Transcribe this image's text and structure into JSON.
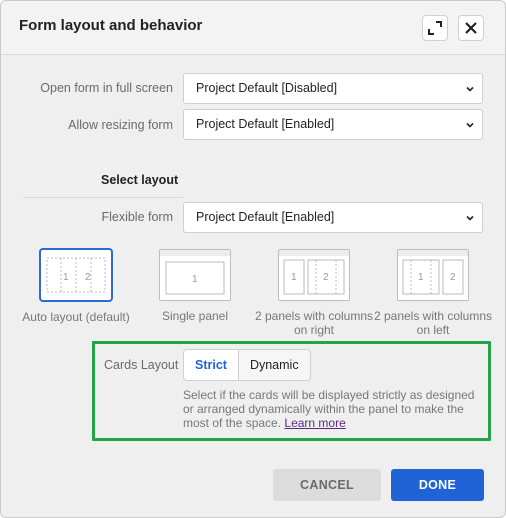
{
  "dialog": {
    "title": "Form layout and behavior"
  },
  "fields": {
    "full_screen": {
      "label": "Open form in full screen",
      "value": "Project Default [Disabled]"
    },
    "resizing": {
      "label": "Allow resizing form",
      "value": "Project Default [Enabled]"
    },
    "flexible": {
      "label": "Flexible form",
      "value": "Project Default [Enabled]"
    }
  },
  "layout_section": {
    "title": "Select layout",
    "options": [
      {
        "label": "Auto layout (default)",
        "selected": true,
        "thumb": [
          "1",
          "2"
        ]
      },
      {
        "label": "Single panel",
        "selected": false,
        "thumb": [
          "1"
        ]
      },
      {
        "label": "2 panels with columns on right",
        "selected": false,
        "thumb": [
          "1",
          "2"
        ]
      },
      {
        "label": "2 panels with columns on left",
        "selected": false,
        "thumb": [
          "1",
          "2"
        ]
      }
    ]
  },
  "cards_layout": {
    "label": "Cards Layout",
    "options": [
      "Strict",
      "Dynamic"
    ],
    "selected": "Strict",
    "helper_text": "Select if the cards will be displayed strictly as designed or arranged dynamically within the panel to make the most of the space.",
    "learn_more": "Learn more",
    "highlight_color": "#22a447"
  },
  "footer": {
    "cancel_label": "CANCEL",
    "done_label": "DONE"
  },
  "colors": {
    "primary": "#1f63d6",
    "background": "#efefef"
  },
  "icons": {
    "expand": "expand-icon",
    "close": "close-icon",
    "dropdown": "chevron-down-icon"
  }
}
